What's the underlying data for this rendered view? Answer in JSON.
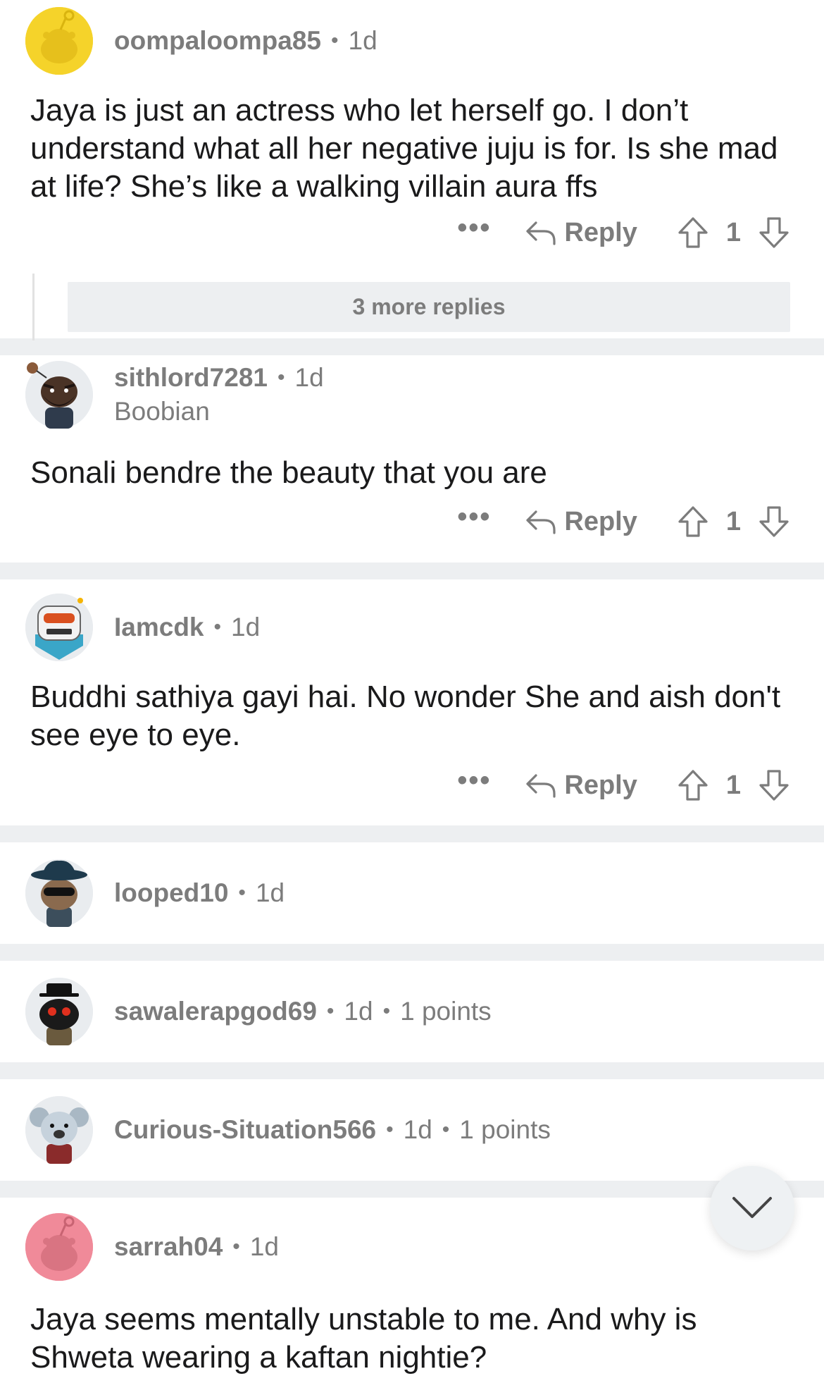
{
  "comments": [
    {
      "username": "oompaloompa85",
      "age": "1d",
      "body": "Jaya is just an actress who let herself go.  I don’t understand what all her negative juju is for.  Is she mad at life?  She’s like a walking villain aura ffs",
      "reply_label": "Reply",
      "score": "1",
      "more_replies": "3 more replies",
      "avatar_color": "#f5d32a"
    },
    {
      "username": "sithlord7281",
      "age": "1d",
      "flair": "Boobian",
      "body": "Sonali bendre the beauty that you are",
      "reply_label": "Reply",
      "score": "1"
    },
    {
      "username": "Iamcdk",
      "age": "1d",
      "body": "Buddhi sathiya gayi hai. No wonder She and aish don't see eye to eye.",
      "reply_label": "Reply",
      "score": "1"
    },
    {
      "username": "looped10",
      "age": "1d"
    },
    {
      "username": "sawalerapgod69",
      "age": "1d",
      "points": "1 points"
    },
    {
      "username": "Curious-Situation566",
      "age": "1d",
      "points": "1 points"
    },
    {
      "username": "sarrah04",
      "age": "1d",
      "body": "Jaya seems mentally unstable to me. And why is Shweta wearing a kaftan nightie?",
      "avatar_color": "#f08a99"
    }
  ],
  "more_actions_glyph": "•••",
  "colors": {
    "meta_text": "#7c7c7c",
    "separator": "#edeff1",
    "body_text": "#1a1a1b"
  },
  "icons": {
    "reply": "reply-arrow-icon",
    "upvote": "upvote-arrow-icon",
    "downvote": "downvote-arrow-icon",
    "collapse": "chevron-down-icon"
  }
}
